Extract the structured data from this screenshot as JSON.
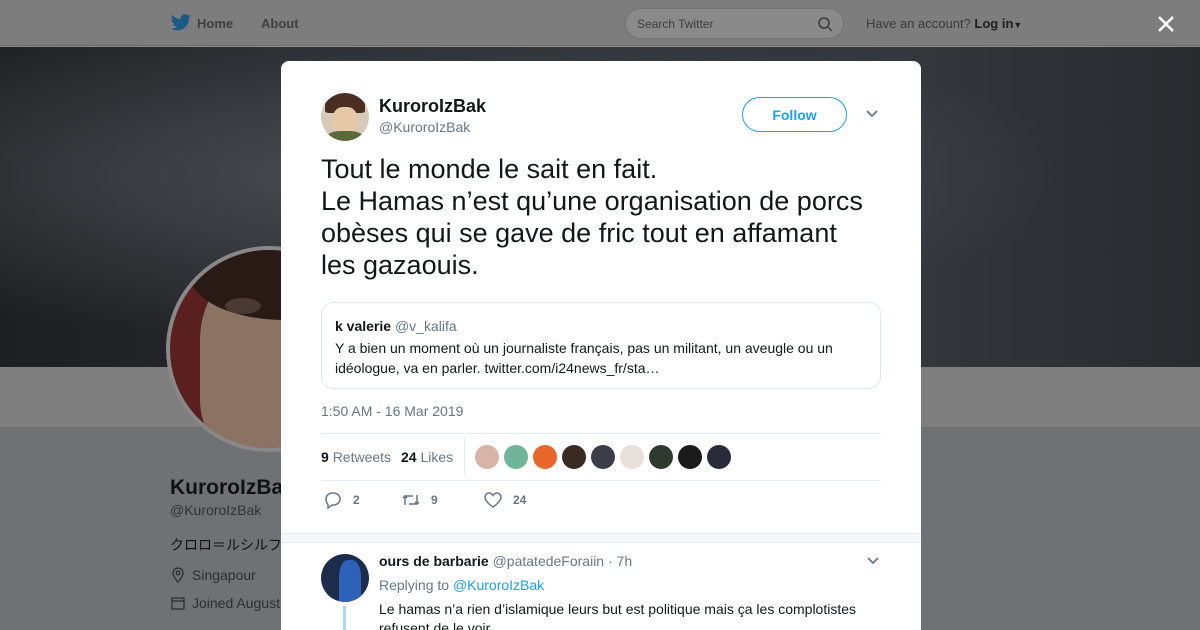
{
  "topbar": {
    "home_label": "Home",
    "about_label": "About",
    "search_placeholder": "Search Twitter",
    "account_prompt": "Have an account?",
    "login_label": "Log in"
  },
  "profile": {
    "name": "KuroroIzBak",
    "handle": "@KuroroIzBak",
    "bio": "クロロ＝ルシルフ",
    "location": "Singapour",
    "joined": "Joined August"
  },
  "tweet": {
    "author_name": "KuroroIzBak",
    "author_handle": "@KuroroIzBak",
    "follow_label": "Follow",
    "text_lines": [
      "Tout le monde le sait en fait.",
      "Le Hamas n’est qu’une organisation de porcs",
      "obèses qui se gave de fric tout en affamant",
      "les gazaouis."
    ],
    "quote": {
      "name": "k valerie",
      "handle": "@v_kalifa",
      "text": "Y a bien un moment où un journaliste français, pas un militant, un aveugle ou un idéologue, va en parler. twitter.com/i24news_fr/sta…"
    },
    "timestamp": "1:50 AM - 16 Mar 2019",
    "retweets_count": "9",
    "retweets_label": "Retweets",
    "likes_count": "24",
    "likes_label": "Likes",
    "liker_colors": [
      "#d8b4a8",
      "#6fb59a",
      "#e8662a",
      "#3a2a22",
      "#3d3d4a",
      "#e8e0d8",
      "#2f3a2f",
      "#1a1a1a",
      "#2a2a3a"
    ],
    "actions": {
      "replies": "2",
      "retweets": "9",
      "likes": "24"
    }
  },
  "reply": {
    "name": "ours de barbarie",
    "handle": "@patatedeForaiin",
    "time": "· 7h",
    "replying_prefix": "Replying to",
    "replying_to": "@KuroroIzBak",
    "text": "Le hamas n’a rien d’islamique leurs but est politique mais ça les complotistes refusent de le voir"
  },
  "colors": {
    "accent": "#1da1f2",
    "overlay": "#7d7d7d"
  }
}
